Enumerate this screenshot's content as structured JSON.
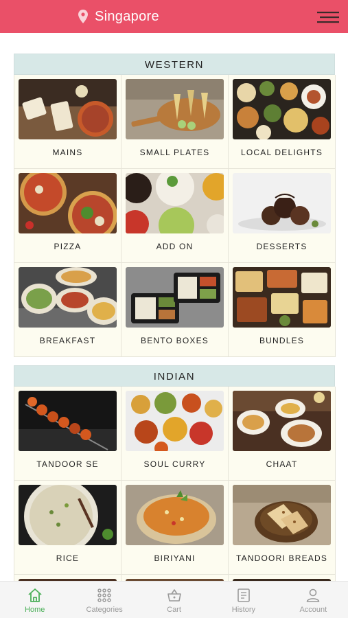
{
  "header": {
    "location": "Singapore",
    "pin_icon": "location-pin-icon",
    "menu_icon": "hamburger-menu-icon"
  },
  "sections": [
    {
      "title": "WESTERN",
      "items": [
        {
          "label": "MAINS"
        },
        {
          "label": "SMALL PLATES"
        },
        {
          "label": "LOCAL DELIGHTS"
        },
        {
          "label": "PIZZA"
        },
        {
          "label": "ADD ON"
        },
        {
          "label": "DESSERTS"
        },
        {
          "label": "BREAKFAST"
        },
        {
          "label": "BENTO BOXES"
        },
        {
          "label": "BUNDLES"
        }
      ]
    },
    {
      "title": "INDIAN",
      "items": [
        {
          "label": "TANDOOR SE"
        },
        {
          "label": "SOUL CURRY"
        },
        {
          "label": "CHAAT"
        },
        {
          "label": "RICE"
        },
        {
          "label": "BIRIYANI"
        },
        {
          "label": "TANDOORI BREADS"
        }
      ]
    }
  ],
  "nav": [
    {
      "label": "Home",
      "icon": "home-icon",
      "active": true
    },
    {
      "label": "Categories",
      "icon": "grid-icon",
      "active": false
    },
    {
      "label": "Cart",
      "icon": "basket-icon",
      "active": false
    },
    {
      "label": "History",
      "icon": "receipt-icon",
      "active": false
    },
    {
      "label": "Account",
      "icon": "person-icon",
      "active": false
    }
  ],
  "colors": {
    "brand": "#ea5068",
    "section_header": "#d7e8e7",
    "tile_bg": "#fdfcf0",
    "nav_active": "#4cb05a",
    "nav_inactive": "#9a9a9a"
  }
}
